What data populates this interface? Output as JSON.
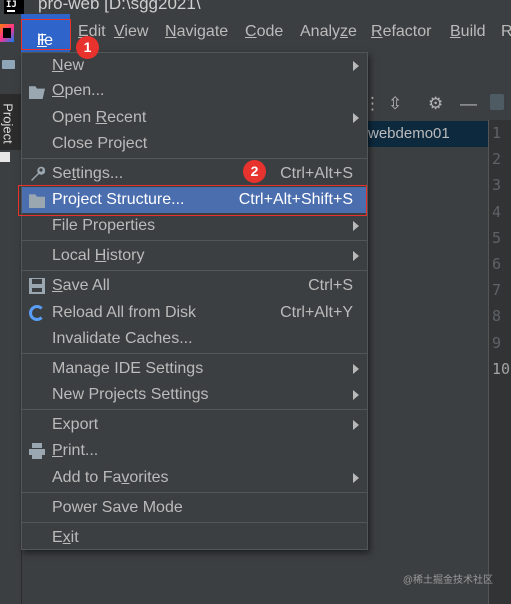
{
  "window": {
    "title": "pro-web [D:\\sgg2021\\",
    "logo": "IJ"
  },
  "menubar": {
    "items": [
      {
        "pre": "",
        "mnemonic": "F",
        "post": "ile"
      },
      {
        "pre": "",
        "mnemonic": "E",
        "post": "dit"
      },
      {
        "pre": "",
        "mnemonic": "V",
        "post": "iew"
      },
      {
        "pre": "",
        "mnemonic": "N",
        "post": "avigate"
      },
      {
        "pre": "",
        "mnemonic": "C",
        "post": "ode"
      },
      {
        "pre": "Analy",
        "mnemonic": "z",
        "post": "e"
      },
      {
        "pre": "",
        "mnemonic": "R",
        "post": "efactor"
      },
      {
        "pre": "",
        "mnemonic": "B",
        "post": "uild"
      },
      {
        "pre": "R",
        "mnemonic": "",
        "post": ""
      }
    ]
  },
  "left_panel": {
    "project_tab": "Project"
  },
  "project_tree": {
    "selected_row": "webdemo01"
  },
  "gutter": {
    "lines": [
      "1",
      "2",
      "3",
      "4",
      "5",
      "6",
      "7",
      "8",
      "9",
      "10"
    ]
  },
  "file_menu": {
    "items": [
      {
        "pre": "",
        "mnemonic": "N",
        "post": "ew",
        "shortcut": "",
        "submenu": true,
        "icon": ""
      },
      {
        "pre": "",
        "mnemonic": "O",
        "post": "pen...",
        "shortcut": "",
        "submenu": false,
        "icon": "open-folder-icon"
      },
      {
        "pre": "Open ",
        "mnemonic": "R",
        "post": "ecent",
        "shortcut": "",
        "submenu": true,
        "icon": ""
      },
      {
        "pre": "Close Project",
        "mnemonic": "",
        "post": "",
        "shortcut": "",
        "submenu": false,
        "icon": ""
      },
      {
        "pre": "Se",
        "mnemonic": "t",
        "post": "tings...",
        "shortcut": "Ctrl+Alt+S",
        "submenu": false,
        "icon": "wrench-icon"
      },
      {
        "pre": "Project Structure...",
        "mnemonic": "",
        "post": "",
        "shortcut": "Ctrl+Alt+Shift+S",
        "submenu": false,
        "icon": "project-structure-icon",
        "selected": true
      },
      {
        "pre": "File Properties",
        "mnemonic": "",
        "post": "",
        "shortcut": "",
        "submenu": true,
        "icon": ""
      },
      {
        "pre": "Local ",
        "mnemonic": "H",
        "post": "istory",
        "shortcut": "",
        "submenu": true,
        "icon": ""
      },
      {
        "pre": "",
        "mnemonic": "S",
        "post": "ave All",
        "shortcut": "Ctrl+S",
        "submenu": false,
        "icon": "save-icon"
      },
      {
        "pre": "Reload All from Disk",
        "mnemonic": "",
        "post": "",
        "shortcut": "Ctrl+Alt+Y",
        "submenu": false,
        "icon": "reload-icon"
      },
      {
        "pre": "Invalidate Caches...",
        "mnemonic": "",
        "post": "",
        "shortcut": "",
        "submenu": false,
        "icon": ""
      },
      {
        "pre": "Manage IDE Settings",
        "mnemonic": "",
        "post": "",
        "shortcut": "",
        "submenu": true,
        "icon": ""
      },
      {
        "pre": "New Projects Settings",
        "mnemonic": "",
        "post": "",
        "shortcut": "",
        "submenu": true,
        "icon": ""
      },
      {
        "pre": "Export",
        "mnemonic": "",
        "post": "",
        "shortcut": "",
        "submenu": true,
        "icon": ""
      },
      {
        "pre": "",
        "mnemonic": "P",
        "post": "rint...",
        "shortcut": "",
        "submenu": false,
        "icon": "print-icon"
      },
      {
        "pre": "Add to Fa",
        "mnemonic": "v",
        "post": "orites",
        "shortcut": "",
        "submenu": true,
        "icon": ""
      },
      {
        "pre": "Power Save Mode",
        "mnemonic": "",
        "post": "",
        "shortcut": "",
        "submenu": false,
        "icon": ""
      },
      {
        "pre": "E",
        "mnemonic": "x",
        "post": "it",
        "shortcut": "",
        "submenu": false,
        "icon": ""
      }
    ]
  },
  "annotations": {
    "badge1": "1",
    "badge2": "2",
    "color": "#e8322e"
  },
  "watermark": "@稀土掘金技术社区",
  "colors": {
    "menu_bg": "#3c3f41",
    "selection": "#4b6eaf",
    "menubar_active": "#2f65ca"
  }
}
